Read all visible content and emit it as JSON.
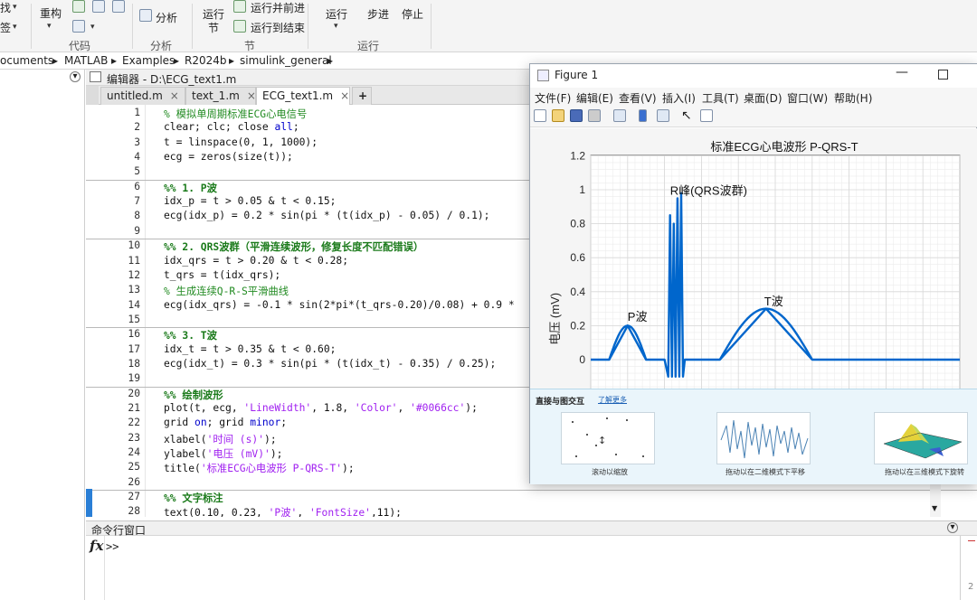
{
  "ribbon": {
    "left_cut1": "找",
    "left_cut2": "签",
    "refactor": "重构",
    "analyze": "分析",
    "run_section": "运行",
    "run_section2": "节",
    "run_advance": "运行并前进",
    "run_to_end": "运行到结束",
    "run": "运行",
    "step": "步进",
    "stop": "停止",
    "groups": {
      "code": "代码",
      "analysis": "分析",
      "section": "节",
      "run": "运行"
    }
  },
  "address": {
    "crumbs": [
      "ocuments",
      "MATLAB",
      "Examples",
      "R2024b",
      "simulink_general"
    ]
  },
  "editor": {
    "header": "编辑器 - D:\\ECG_text1.m",
    "tabs": [
      {
        "label": "untitled.m"
      },
      {
        "label": "text_1.m"
      },
      {
        "label": "ECG_text1.m"
      }
    ],
    "add_tab": "+",
    "lines": [
      {
        "n": "1",
        "t": "% 模拟单周期标准ECG心电信号"
      },
      {
        "n": "2",
        "t": "clear; clc; close all;"
      },
      {
        "n": "3",
        "t": "t = linspace(0, 1, 1000);"
      },
      {
        "n": "4",
        "t": "ecg = zeros(size(t));"
      },
      {
        "n": "5",
        "t": ""
      },
      {
        "n": "6",
        "t": "%% 1. P波"
      },
      {
        "n": "7",
        "t": "idx_p = t > 0.05 & t < 0.15;"
      },
      {
        "n": "8",
        "t": "ecg(idx_p) = 0.2 * sin(pi * (t(idx_p) - 0.05) / 0.1);"
      },
      {
        "n": "9",
        "t": ""
      },
      {
        "n": "10",
        "t": "%% 2. QRS波群（平滑连续波形，修复长度不匹配错误）"
      },
      {
        "n": "11",
        "t": "idx_qrs = t > 0.20 & t < 0.28;"
      },
      {
        "n": "12",
        "t": "t_qrs = t(idx_qrs);"
      },
      {
        "n": "13",
        "t": "% 生成连续Q-R-S平滑曲线"
      },
      {
        "n": "14",
        "t": "ecg(idx_qrs) = -0.1 * sin(2*pi*(t_qrs-0.20)/0.08) + 0.9 *"
      },
      {
        "n": "15",
        "t": ""
      },
      {
        "n": "16",
        "t": "%% 3. T波"
      },
      {
        "n": "17",
        "t": "idx_t = t > 0.35 & t < 0.60;"
      },
      {
        "n": "18",
        "t": "ecg(idx_t) = 0.3 * sin(pi * (t(idx_t) - 0.35) / 0.25);"
      },
      {
        "n": "19",
        "t": ""
      },
      {
        "n": "20",
        "t": "%% 绘制波形"
      },
      {
        "n": "21",
        "t": "plot(t, ecg, 'LineWidth', 1.8, 'Color', '#0066cc');"
      },
      {
        "n": "22",
        "t": "grid on; grid minor;"
      },
      {
        "n": "23",
        "t": "xlabel('时间 (s)');"
      },
      {
        "n": "24",
        "t": "ylabel('电压 (mV)');"
      },
      {
        "n": "25",
        "t": "title('标准ECG心电波形 P-QRS-T');"
      },
      {
        "n": "26",
        "t": ""
      },
      {
        "n": "27",
        "t": "%% 文字标注"
      },
      {
        "n": "28",
        "t": "text(0.10, 0.23, 'P波', 'FontSize',11);"
      }
    ]
  },
  "command_window": {
    "title": "命令行窗口",
    "prompt": ">>",
    "fx": "fx"
  },
  "figure": {
    "title": "Figure 1",
    "menu": [
      "文件(F)",
      "编辑(E)",
      "查看(V)",
      "插入(I)",
      "工具(T)",
      "桌面(D)",
      "窗口(W)",
      "帮助(H)"
    ],
    "toolbar_icons": [
      "new-file-icon",
      "open-folder-icon",
      "save-icon",
      "print-icon",
      "link-plot-icon",
      "colorbar-icon",
      "legend-icon",
      "pointer-icon",
      "property-inspector-icon"
    ],
    "interact_panel": {
      "title": "直接与图交互",
      "link": "了解更多",
      "captions": [
        "滚动以缩放",
        "拖动以在二维模式下平移",
        "拖动以在三维模式下旋转"
      ]
    }
  },
  "chart_data": {
    "type": "line",
    "title": "标准ECG心电波形 P-QRS-T",
    "xlabel": "",
    "ylabel": "电压 (mV)",
    "ylim": [
      -0.15,
      1.2
    ],
    "xlim": [
      0,
      1
    ],
    "yticks": [
      "1.2",
      "1",
      "0.8",
      "0.6",
      "0.4",
      "0.2",
      "0"
    ],
    "grid": "on, minor",
    "series": [
      {
        "name": "",
        "color": "#0066cc",
        "x": [
          0,
          0.05,
          0.1,
          0.15,
          0.2,
          0.21,
          0.215,
          0.22,
          0.225,
          0.23,
          0.235,
          0.24,
          0.245,
          0.25,
          0.255,
          0.26,
          0.265,
          0.27,
          0.28,
          0.35,
          0.475,
          0.6,
          1
        ],
        "y": [
          0,
          0,
          0.2,
          0,
          0,
          -0.1,
          0.85,
          -0.1,
          0.8,
          -0.1,
          0.95,
          -0.1,
          0.98,
          -0.1,
          0,
          0,
          0,
          0,
          0,
          0,
          0.3,
          0,
          0
        ]
      }
    ],
    "annotations": [
      {
        "text": "P波",
        "x": 0.1,
        "y": 0.23
      },
      {
        "text": "R峰(QRS波群)",
        "x": 0.215,
        "y": 0.97
      },
      {
        "text": "T波",
        "x": 0.47,
        "y": 0.32
      }
    ]
  }
}
